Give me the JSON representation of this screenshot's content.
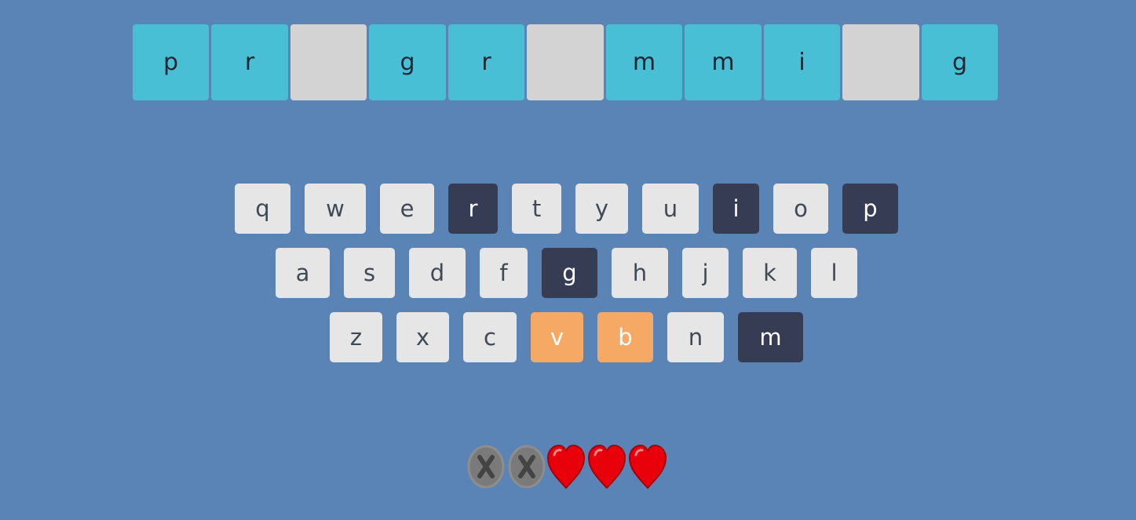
{
  "word": {
    "slots": [
      {
        "letter": "p",
        "state": "revealed"
      },
      {
        "letter": "r",
        "state": "revealed"
      },
      {
        "letter": "",
        "state": "hidden"
      },
      {
        "letter": "g",
        "state": "revealed"
      },
      {
        "letter": "r",
        "state": "revealed"
      },
      {
        "letter": "",
        "state": "hidden"
      },
      {
        "letter": "m",
        "state": "revealed"
      },
      {
        "letter": "m",
        "state": "revealed"
      },
      {
        "letter": "i",
        "state": "revealed"
      },
      {
        "letter": "",
        "state": "hidden"
      },
      {
        "letter": "g",
        "state": "revealed"
      }
    ]
  },
  "keyboard": {
    "row1": [
      {
        "label": "q",
        "state": "available"
      },
      {
        "label": "w",
        "state": "available"
      },
      {
        "label": "e",
        "state": "available"
      },
      {
        "label": "r",
        "state": "used"
      },
      {
        "label": "t",
        "state": "available"
      },
      {
        "label": "y",
        "state": "available"
      },
      {
        "label": "u",
        "state": "available"
      },
      {
        "label": "i",
        "state": "used"
      },
      {
        "label": "o",
        "state": "available"
      },
      {
        "label": "p",
        "state": "used"
      }
    ],
    "row2": [
      {
        "label": "a",
        "state": "available"
      },
      {
        "label": "s",
        "state": "available"
      },
      {
        "label": "d",
        "state": "available"
      },
      {
        "label": "f",
        "state": "available"
      },
      {
        "label": "g",
        "state": "used"
      },
      {
        "label": "h",
        "state": "available"
      },
      {
        "label": "j",
        "state": "available"
      },
      {
        "label": "k",
        "state": "available"
      },
      {
        "label": "l",
        "state": "available"
      }
    ],
    "row3": [
      {
        "label": "z",
        "state": "available"
      },
      {
        "label": "x",
        "state": "available"
      },
      {
        "label": "c",
        "state": "available"
      },
      {
        "label": "v",
        "state": "wrong"
      },
      {
        "label": "b",
        "state": "wrong"
      },
      {
        "label": "n",
        "state": "available"
      },
      {
        "label": "m",
        "state": "used"
      }
    ]
  },
  "lives": {
    "total": 5,
    "lost": 2,
    "remaining": 3,
    "icons": [
      "lost-life-icon",
      "lost-life-icon",
      "heart-icon",
      "heart-icon",
      "heart-icon"
    ]
  },
  "colors": {
    "background": "#5b84b6",
    "revealed_slot": "#49bfd6",
    "hidden_slot": "#d3d3d3",
    "key_available": "#e6e6e6",
    "key_used": "#373c55",
    "key_wrong": "#f6a964",
    "heart": "#e8000b",
    "lost_life": "#7a7a7a"
  }
}
